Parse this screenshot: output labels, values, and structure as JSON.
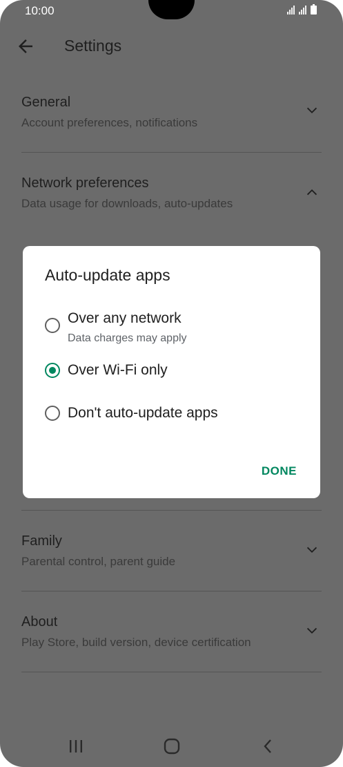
{
  "status": {
    "time": "10:00"
  },
  "appbar": {
    "title": "Settings"
  },
  "settings": {
    "general": {
      "title": "General",
      "subtitle": "Account preferences, notifications"
    },
    "network": {
      "title": "Network preferences",
      "subtitle": "Data usage for downloads, auto-updates"
    },
    "family": {
      "title": "Family",
      "subtitle": "Parental control, parent guide"
    },
    "about": {
      "title": "About",
      "subtitle": "Play Store, build version, device certification"
    }
  },
  "dialog": {
    "title": "Auto-update apps",
    "options": [
      {
        "label": "Over any network",
        "sublabel": "Data charges may apply",
        "selected": false
      },
      {
        "label": "Over Wi-Fi only",
        "selected": true
      },
      {
        "label": "Don't auto-update apps",
        "selected": false
      }
    ],
    "done_label": "DONE"
  },
  "colors": {
    "accent": "#01875f",
    "scrim": "#6b6b6b",
    "dialog_bg": "#ffffff"
  },
  "icons": [
    "back-arrow-icon",
    "chevron-down-icon",
    "chevron-up-icon",
    "recent-apps-icon",
    "home-icon",
    "back-icon"
  ]
}
